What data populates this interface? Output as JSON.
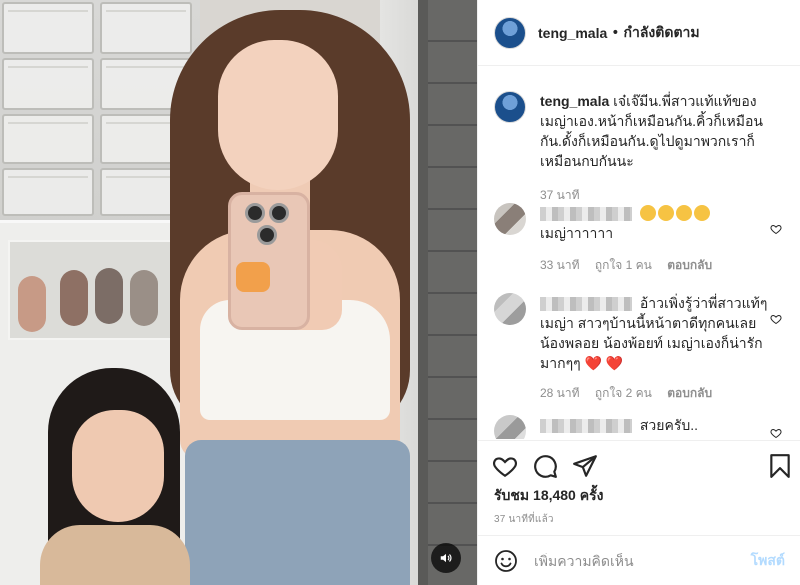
{
  "post": {
    "username": "teng_mala",
    "separator": "•",
    "follow_status": "กำลังติดตาม",
    "caption": "เจ๋เจ๊มีน.พี่สาวแท้แท้ของเมญ่าเอง.หน้าก็เหมือนกัน.คิ้วก็เหมือนกัน.ดั้งก็เหมือนกัน.ดูไปดูมาพวกเราก็เหมือนกบกันนะ",
    "caption_time": "37 นาที"
  },
  "comments": [
    {
      "text": "เมญ่าาาาาา",
      "time": "33 นาที",
      "likes": "ถูกใจ 1 คน",
      "reply": "ตอบกลับ",
      "emoji_count": 4
    },
    {
      "text": "อ้าวเพิ่งรู้ว่าพี่สาวแท้ๆเมญ่า สาวๆบ้านนี้หน้าตาดีทุกคนเลย น้องพลอย น้องพ้อยท์ เมญ่าเองก็น่ารักมากๆๆ ",
      "hearts": "❤️ ❤️",
      "time": "28 นาที",
      "likes": "ถูกใจ 2 คน",
      "reply": "ตอบกลับ"
    },
    {
      "text": "สวยครับ.."
    }
  ],
  "stats": {
    "likes": "รับชม 18,480 ครั้ง",
    "time_ago": "37 นาทีที่แล้ว"
  },
  "composer": {
    "placeholder": "เพิ่มความคิดเห็น",
    "post_label": "โพสต์"
  },
  "icons": {
    "like": "heart-icon",
    "comment": "comment-icon",
    "share": "share-icon",
    "save": "bookmark-icon",
    "emoji": "emoji-icon",
    "sound": "speaker-icon"
  },
  "colors": {
    "post_button": "#b3dbff",
    "meta_text": "#8e8e8e",
    "heart_red": "#e0243a"
  }
}
